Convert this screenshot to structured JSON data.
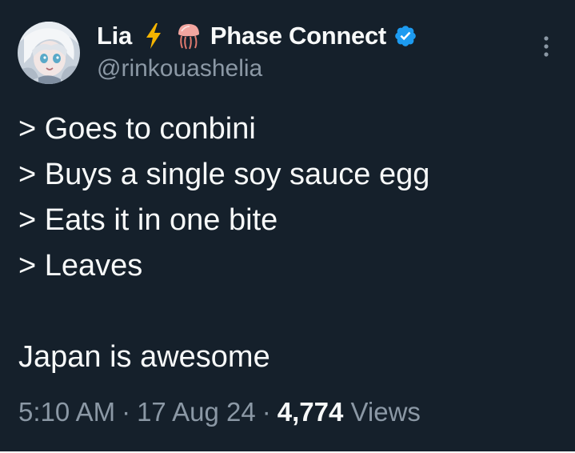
{
  "author": {
    "name": "Lia",
    "affiliation": "Phase Connect",
    "handle": "@rinkouashelia",
    "icons": [
      "avatar",
      "lightning-emoji-icon",
      "jellyfish-emoji-icon",
      "verified-badge-icon",
      "more-options-icon"
    ]
  },
  "tweet": {
    "lines": [
      "> Goes to conbini",
      "> Buys a single soy sauce egg",
      "> Eats it in one bite",
      "> Leaves"
    ],
    "closing": "Japan is awesome"
  },
  "meta": {
    "time": "5:10 AM",
    "date": "17 Aug 24",
    "views_count": "4,774",
    "views_label": "Views",
    "separator": "·"
  },
  "colors": {
    "background": "#15202b",
    "text": "#f7f9f9",
    "muted": "#8b98a5",
    "verified": "#1d9bf0"
  }
}
